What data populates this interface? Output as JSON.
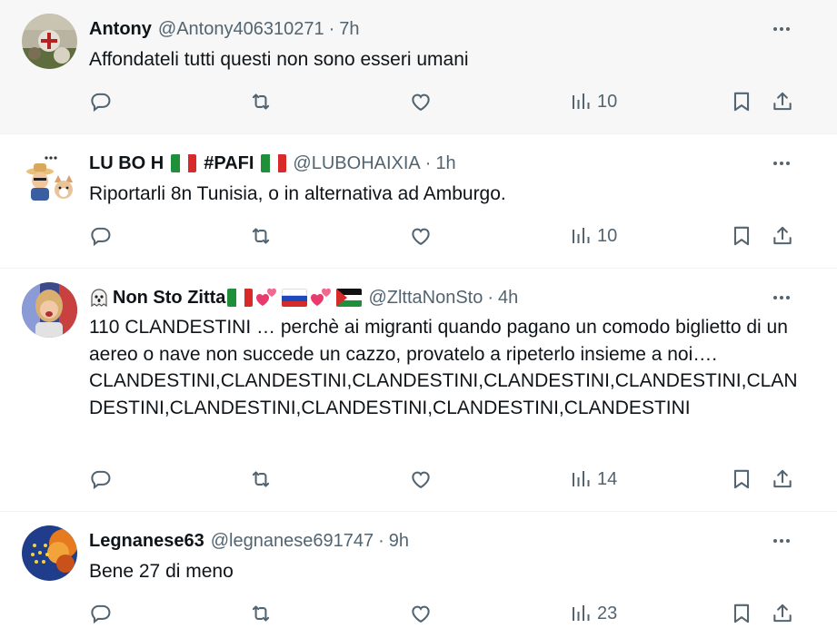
{
  "tweets": [
    {
      "name": "Antony",
      "handle": "@Antony406310271",
      "dot": "·",
      "time": "7h",
      "text": "Affondateli tutti questi non sono esseri umani",
      "views": "10"
    },
    {
      "name": "LU BO H",
      "name2": "#PAFI",
      "handle": "@LUBOHAIXIA",
      "dot": "·",
      "time": "1h",
      "text": "Riportarli 8n Tunisia, o in alternativa ad Amburgo.",
      "views": "10"
    },
    {
      "name": "Non Sto Zitta",
      "handle": "@ZlttaNonSto",
      "dot": "·",
      "time": "4h",
      "text": "110 CLANDESTINI … perchè ai migranti quando pagano un comodo biglietto di un aereo o nave non succede un cazzo, provatelo a ripeterlo insieme a noi….",
      "text2": "CLANDESTINI,CLANDESTINI,CLANDESTINI,CLANDESTINI,CLANDESTINI,CLANDESTINI,CLANDESTINI,CLANDESTINI,CLANDESTINI,CLANDESTINI",
      "views": "14"
    },
    {
      "name": "Legnanese63",
      "handle": "@legnanese691747",
      "dot": "·",
      "time": "9h",
      "text": "Bene 27 di meno",
      "views": "23"
    }
  ],
  "colors": {
    "text": "#0f1419",
    "secondary": "#536471",
    "divider": "#eff3f4",
    "hover_bg": "#f7f7f7"
  },
  "icons": [
    "reply-icon",
    "retweet-icon",
    "like-icon",
    "views-icon",
    "bookmark-icon",
    "share-icon",
    "more-icon"
  ]
}
